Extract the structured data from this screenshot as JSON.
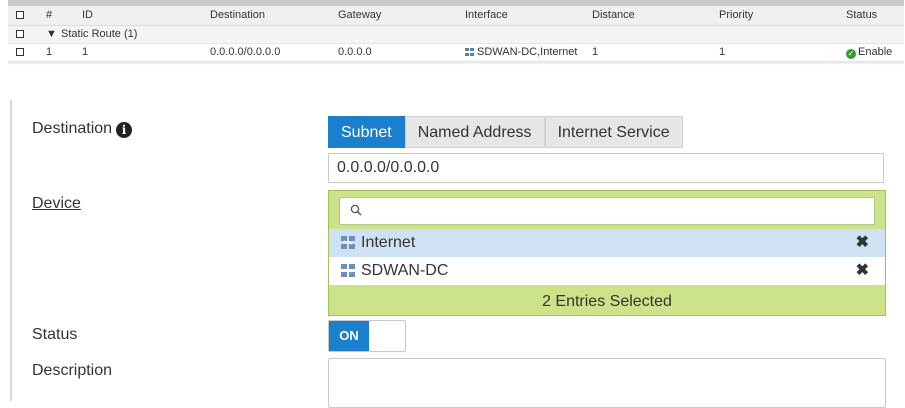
{
  "table": {
    "headers": [
      "#",
      "ID",
      "Destination",
      "Gateway",
      "Interface",
      "Distance",
      "Priority",
      "Status"
    ],
    "group_label": "Static Route (1)",
    "rows": [
      {
        "num": "1",
        "id": "1",
        "destination": "0.0.0.0/0.0.0.0",
        "gateway": "0.0.0.0",
        "interface": "SDWAN-DC,Internet",
        "distance": "1",
        "priority": "1",
        "status": "Enable"
      }
    ]
  },
  "form": {
    "destination_label": "Destination",
    "destination_tabs": [
      "Subnet",
      "Named Address",
      "Internet Service"
    ],
    "destination_value": "0.0.0.0/0.0.0.0",
    "device_label": "Device",
    "device_search_placeholder": "",
    "device_entries": [
      "Internet",
      "SDWAN-DC"
    ],
    "device_summary": "2 Entries Selected",
    "status_label": "Status",
    "status_toggle": "ON",
    "description_label": "Description"
  },
  "colors": {
    "accent": "#1a7fcc",
    "selected_row": "#cfe2f3",
    "device_box": "#cde38a",
    "enable_green": "#3a9a3a"
  }
}
